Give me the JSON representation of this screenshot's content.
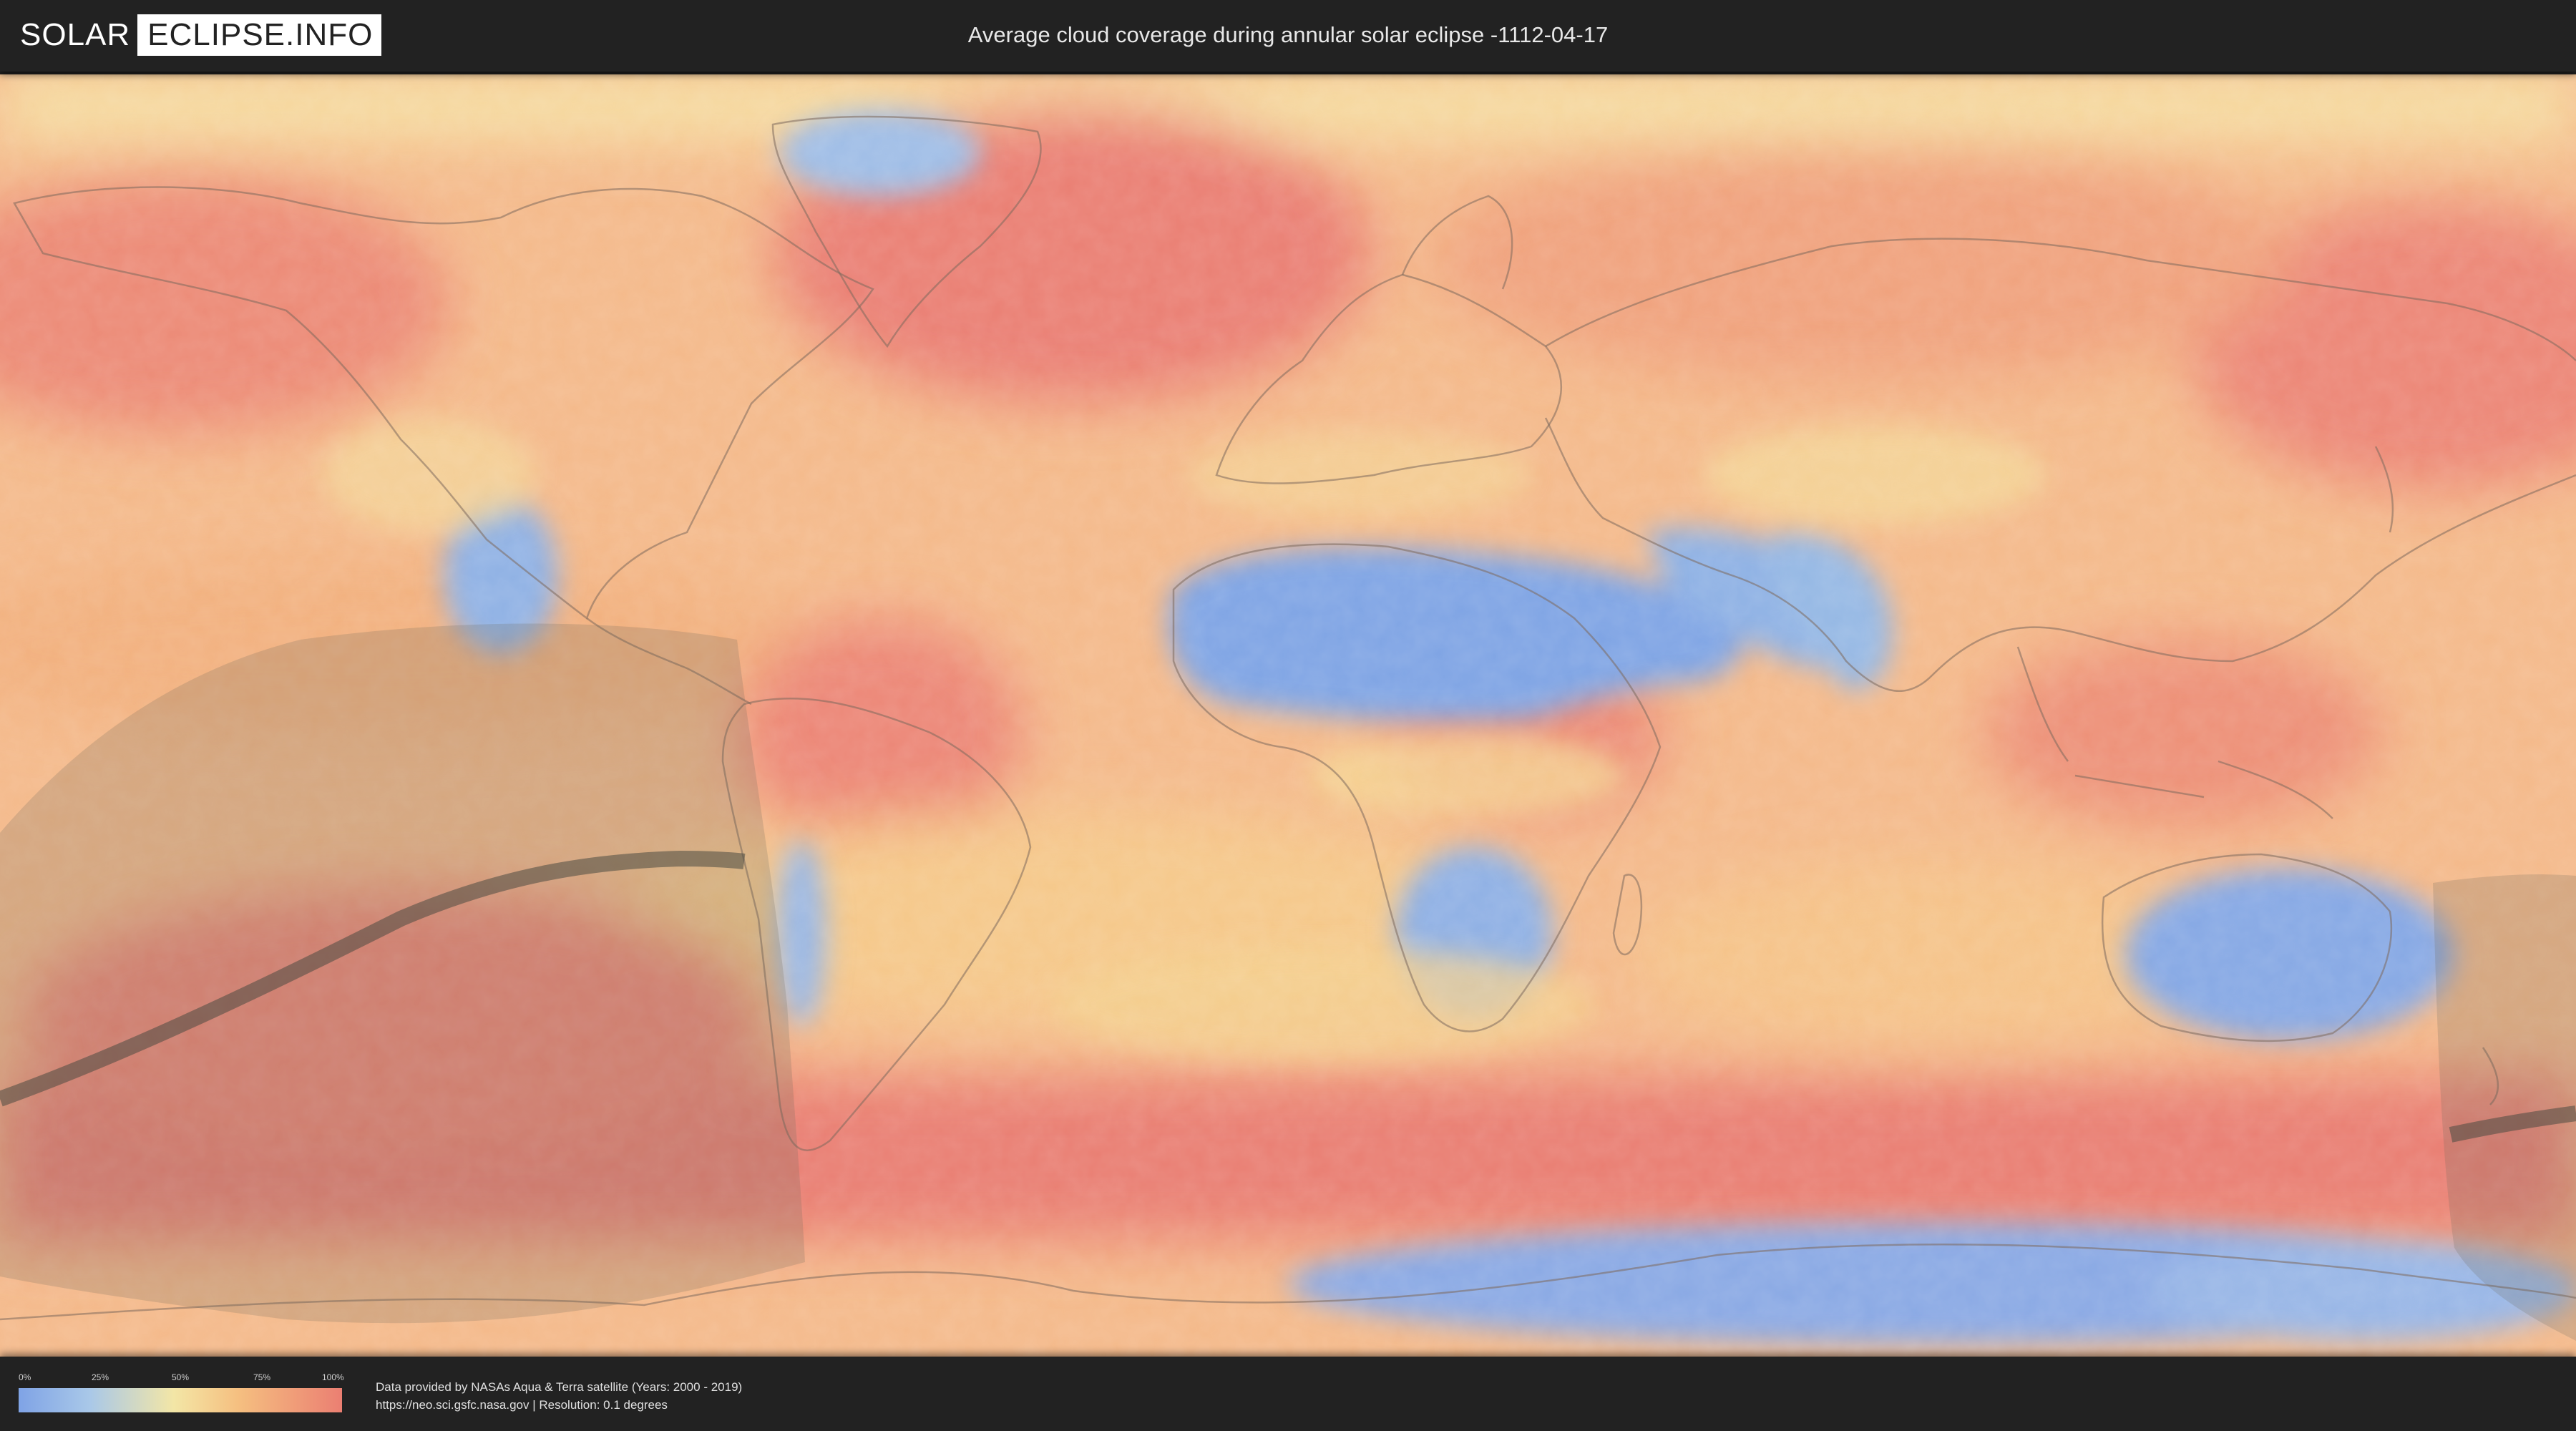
{
  "header": {
    "logo": {
      "left_text": "SOLAR",
      "right_text": "ECLIPSE.INFO"
    },
    "title": "Average cloud coverage during annular solar eclipse -1112-04-17"
  },
  "map": {
    "icon": "world-map",
    "colors": {
      "clear": "#7fa3e6",
      "light": "#a9c8e8",
      "mid": "#f3e6a6",
      "heavy": "#f5bf80",
      "overcast": "#eb7f72",
      "visibility_zone": "#6e6a5c",
      "eclipse_path": "#4b4a42"
    }
  },
  "legend": {
    "ticks": [
      "0%",
      "25%",
      "50%",
      "75%",
      "100%"
    ]
  },
  "credits": {
    "line1": "Data provided by NASAs Aqua & Terra satellite (Years: 2000 - 2019)",
    "line2": "https://neo.sci.gsfc.nasa.gov | Resolution: 0.1 degrees"
  }
}
